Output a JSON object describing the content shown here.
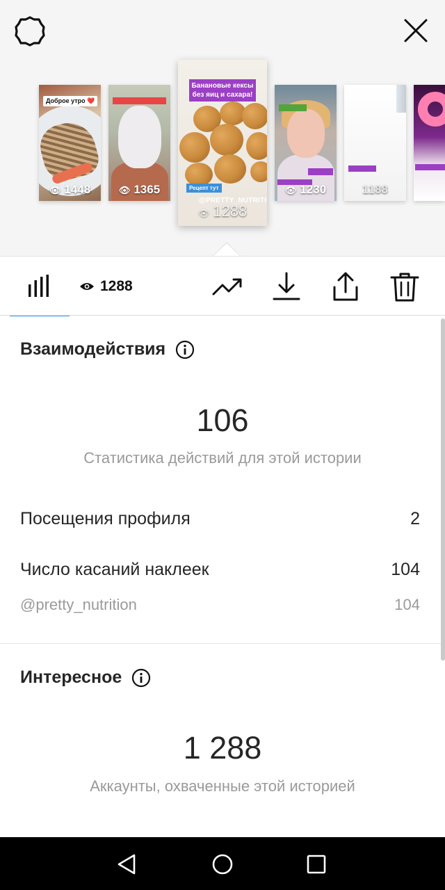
{
  "stories": [
    {
      "views": "1448",
      "caption": "Доброе утро ❤️"
    },
    {
      "views": "1365"
    },
    {
      "views": "1288",
      "caption": "Банановые кексы без яиц и сахара!",
      "sticker": "Рецепт тут",
      "handle": "@PRETTY_NUTRITION"
    },
    {
      "views": "1230"
    },
    {
      "views": "1188"
    }
  ],
  "toolbar": {
    "views_count": "1288"
  },
  "interactions": {
    "title": "Взаимодействия",
    "total": "106",
    "caption": "Статистика действий для этой истории",
    "rows": [
      {
        "label": "Посещения профиля",
        "value": "2"
      },
      {
        "label": "Число касаний наклеек",
        "value": "104"
      },
      {
        "label": "@pretty_nutrition",
        "value": "104"
      }
    ]
  },
  "discovery": {
    "title": "Интересное",
    "total": "1 288",
    "caption": "Аккаунты, охваченные этой историей"
  },
  "colors": {
    "accent": "#3897f0",
    "sticker_purple": "#9b3fc4",
    "text_primary": "#262626",
    "text_secondary": "#9a9a9a"
  },
  "icons": [
    "gear-icon",
    "close-icon",
    "bar-chart-icon",
    "eye-icon",
    "trend-icon",
    "download-icon",
    "share-icon",
    "trash-icon",
    "info-icon",
    "nav-back-icon",
    "nav-home-icon",
    "nav-recent-icon"
  ]
}
